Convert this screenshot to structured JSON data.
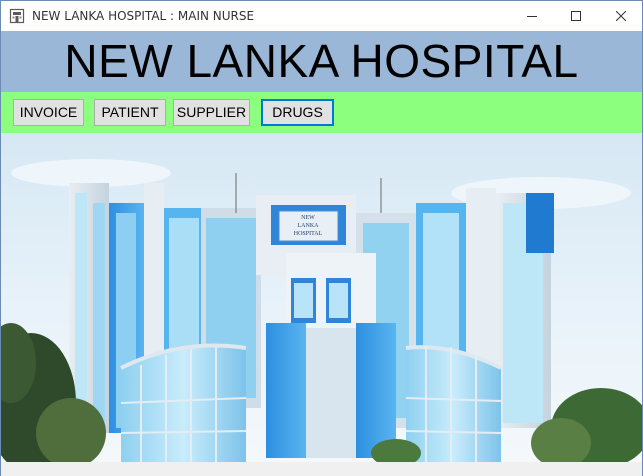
{
  "window": {
    "title": "NEW LANKA HOSPITAL : MAIN NURSE",
    "icon": "hospital-app-icon",
    "controls": [
      "minimize-icon",
      "maximize-icon",
      "close-icon"
    ]
  },
  "header": {
    "title": "NEW LANKA HOSPITAL",
    "background": "#9bb7d8"
  },
  "toolbar": {
    "background": "#8cff7e",
    "buttons": [
      "INVOICE",
      "PATIENT",
      "SUPPLIER",
      "DRUGS"
    ],
    "focused": "DRUGS"
  },
  "photo": {
    "building_sign_line1": "NEW",
    "building_sign_line2": "LANKA",
    "building_sign_line3": "HOSPITAL"
  },
  "colors": {
    "focus_border": "#0078d7",
    "button_face": "#e1e1e1"
  }
}
